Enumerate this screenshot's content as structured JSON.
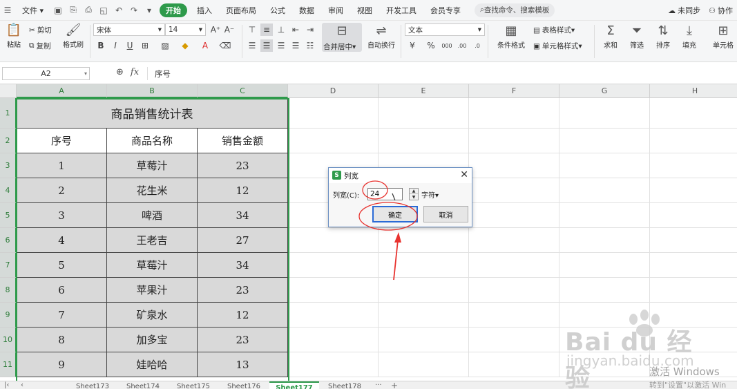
{
  "menubar": {
    "file_label": "文件",
    "tabs": [
      {
        "label": "开始",
        "active": true
      },
      {
        "label": "插入"
      },
      {
        "label": "页面布局"
      },
      {
        "label": "公式"
      },
      {
        "label": "数据"
      },
      {
        "label": "审阅"
      },
      {
        "label": "视图"
      },
      {
        "label": "开发工具"
      },
      {
        "label": "会员专享"
      }
    ],
    "search_placeholder": "查找命令、搜索模板",
    "sync_label": "未同步",
    "collab_label": "协作"
  },
  "ribbon": {
    "paste_label": "粘贴",
    "cut_label": "剪切",
    "copy_label": "复制",
    "format_painter_label": "格式刷",
    "font_name": "宋体",
    "font_size": "14",
    "merge_label": "合并居中",
    "wrap_label": "自动换行",
    "number_format": "文本",
    "cond_format_label": "条件格式",
    "table_style_label": "表格样式",
    "cell_style_label": "单元格样式",
    "sum_label": "求和",
    "filter_label": "筛选",
    "sort_label": "排序",
    "fill_label": "填充",
    "cell_label": "单元格"
  },
  "formula_bar": {
    "cell_ref": "A2",
    "content": "序号"
  },
  "grid": {
    "columns": [
      "A",
      "B",
      "C",
      "D",
      "E",
      "F",
      "G",
      "H"
    ],
    "rows": [
      "1",
      "2",
      "3",
      "4",
      "5",
      "6",
      "7",
      "8",
      "9",
      "10",
      "11"
    ],
    "table_title": "商品销售统计表",
    "headers": [
      "序号",
      "商品名称",
      "销售金额"
    ],
    "data": [
      [
        "1",
        "草莓汁",
        "23"
      ],
      [
        "2",
        "花生米",
        "12"
      ],
      [
        "3",
        "啤酒",
        "34"
      ],
      [
        "4",
        "王老吉",
        "27"
      ],
      [
        "5",
        "草莓汁",
        "34"
      ],
      [
        "6",
        "苹果汁",
        "23"
      ],
      [
        "7",
        "矿泉水",
        "12"
      ],
      [
        "8",
        "加多宝",
        "23"
      ],
      [
        "9",
        "娃哈哈",
        "13"
      ]
    ]
  },
  "sheet_tabs": {
    "tabs": [
      "Sheet173",
      "Sheet174",
      "Sheet175",
      "Sheet176",
      "Sheet177",
      "Sheet178"
    ],
    "active": "Sheet177",
    "more_label": "···",
    "add_label": "+"
  },
  "dialog": {
    "title": "列宽",
    "field_label": "列宽(C):",
    "value": "24",
    "unit_label": "字符",
    "ok_label": "确定",
    "cancel_label": "取消"
  },
  "watermark": {
    "baidu": "Bai du 经验",
    "jingyan": "jingyan.baidu.com",
    "activate_title": "激活 Windows",
    "activate_hint": "转到\"设置\"以激活 Win"
  },
  "colors": {
    "accent": "#2e9a4b",
    "annotation": "#e8332f",
    "dialog_focus": "#2a6ad6"
  }
}
